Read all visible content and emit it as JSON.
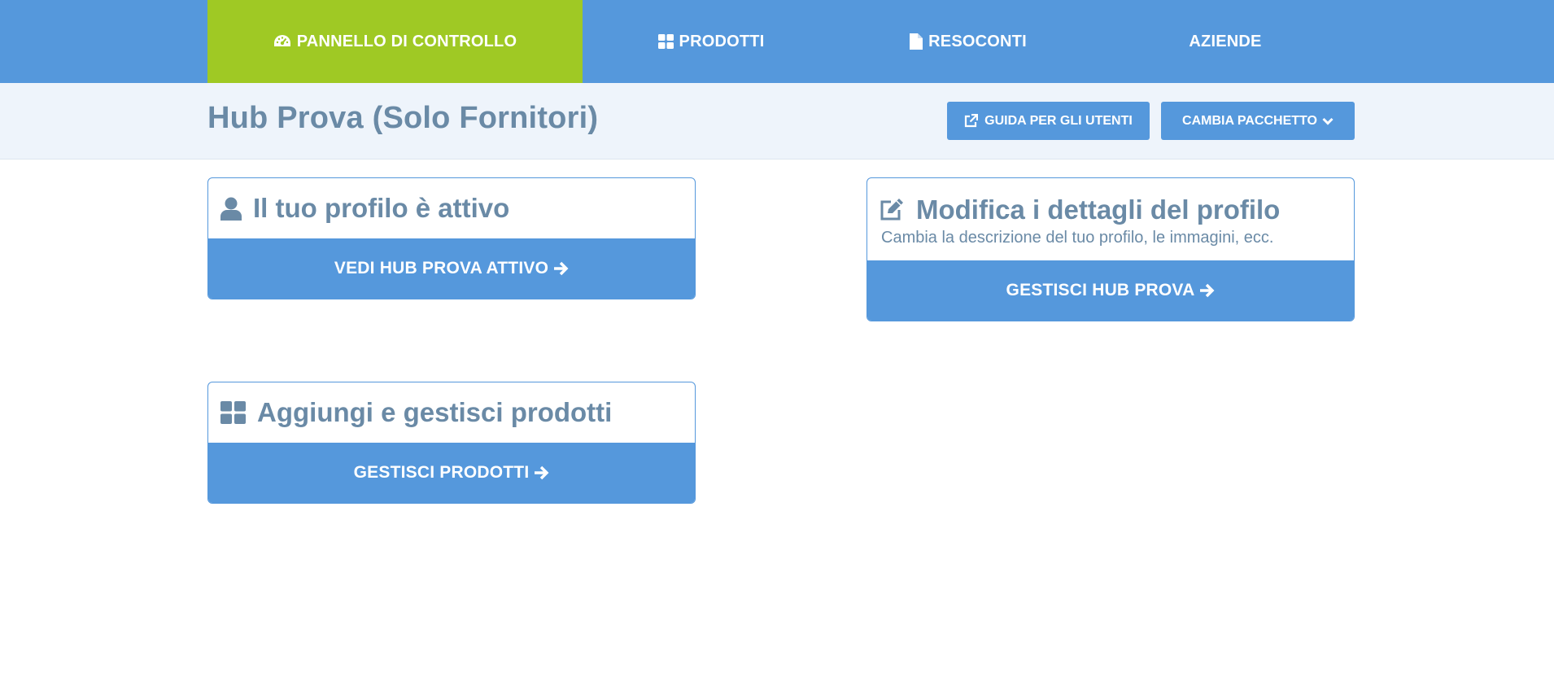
{
  "nav": {
    "items": [
      {
        "label": "PANNELLO DI CONTROLLO",
        "icon": "dashboard-gauge-icon",
        "active": true
      },
      {
        "label": "PRODOTTI",
        "icon": "grid-icon",
        "active": false
      },
      {
        "label": "RESOCONTI",
        "icon": "document-icon",
        "active": false
      },
      {
        "label": "AZIENDE",
        "icon": "",
        "active": false
      }
    ]
  },
  "header": {
    "title": "Hub Prova (Solo Fornitori)",
    "guide_label": "GUIDA PER GLI UTENTI",
    "package_label": "CAMBIA PACCHETTO"
  },
  "cards": {
    "profile_active": {
      "title": "Il tuo profilo è attivo",
      "icon": "user-icon",
      "button": "VEDI HUB PROVA ATTIVO"
    },
    "edit_profile": {
      "title": "Modifica i dettagli del profilo",
      "subtitle": "Cambia la descrizione del tuo profilo, le immagini, ecc.",
      "icon": "edit-icon",
      "button": "GESTISCI HUB PROVA"
    },
    "products": {
      "title": "Aggiungi e gestisci prodotti",
      "icon": "grid-icon",
      "button": "GESTISCI PRODOTTI"
    }
  },
  "colors": {
    "primary": "#5598dc",
    "active_nav": "#9fc924",
    "subheader_bg": "#eef4fb",
    "text_muted": "#6a8aa6"
  }
}
